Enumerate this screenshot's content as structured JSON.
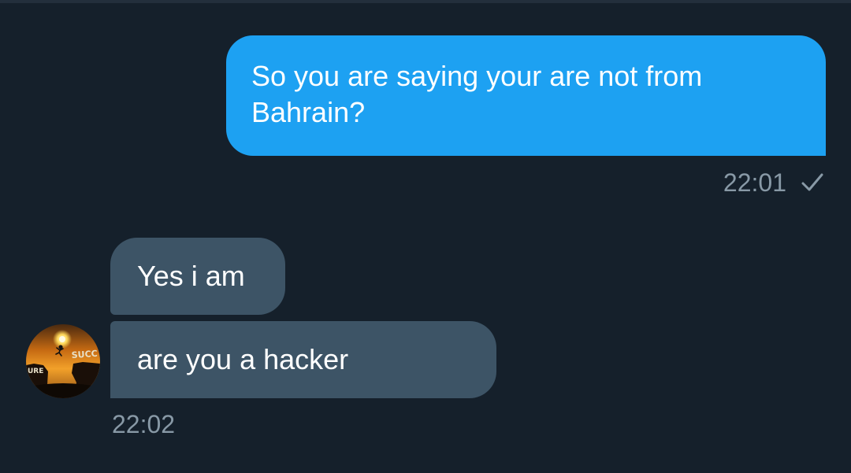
{
  "messages": [
    {
      "direction": "sent",
      "text": "So you are saying your are not from Bahrain?",
      "line1": "So you are saying your are not from",
      "line2": "Bahrain?",
      "time": "22:01",
      "status_icon": "check-icon"
    },
    {
      "direction": "received",
      "text": "Yes i am"
    },
    {
      "direction": "received",
      "text": "are you a hacker",
      "time": "22:02"
    }
  ],
  "avatar": {
    "icon": "sunset-jump-avatar",
    "text_left": "URE",
    "text_right": "SUCC"
  },
  "colors": {
    "background": "#15202b",
    "sent_bubble": "#1da1f2",
    "received_bubble": "#3d5466",
    "timestamp": "#8899a6"
  }
}
